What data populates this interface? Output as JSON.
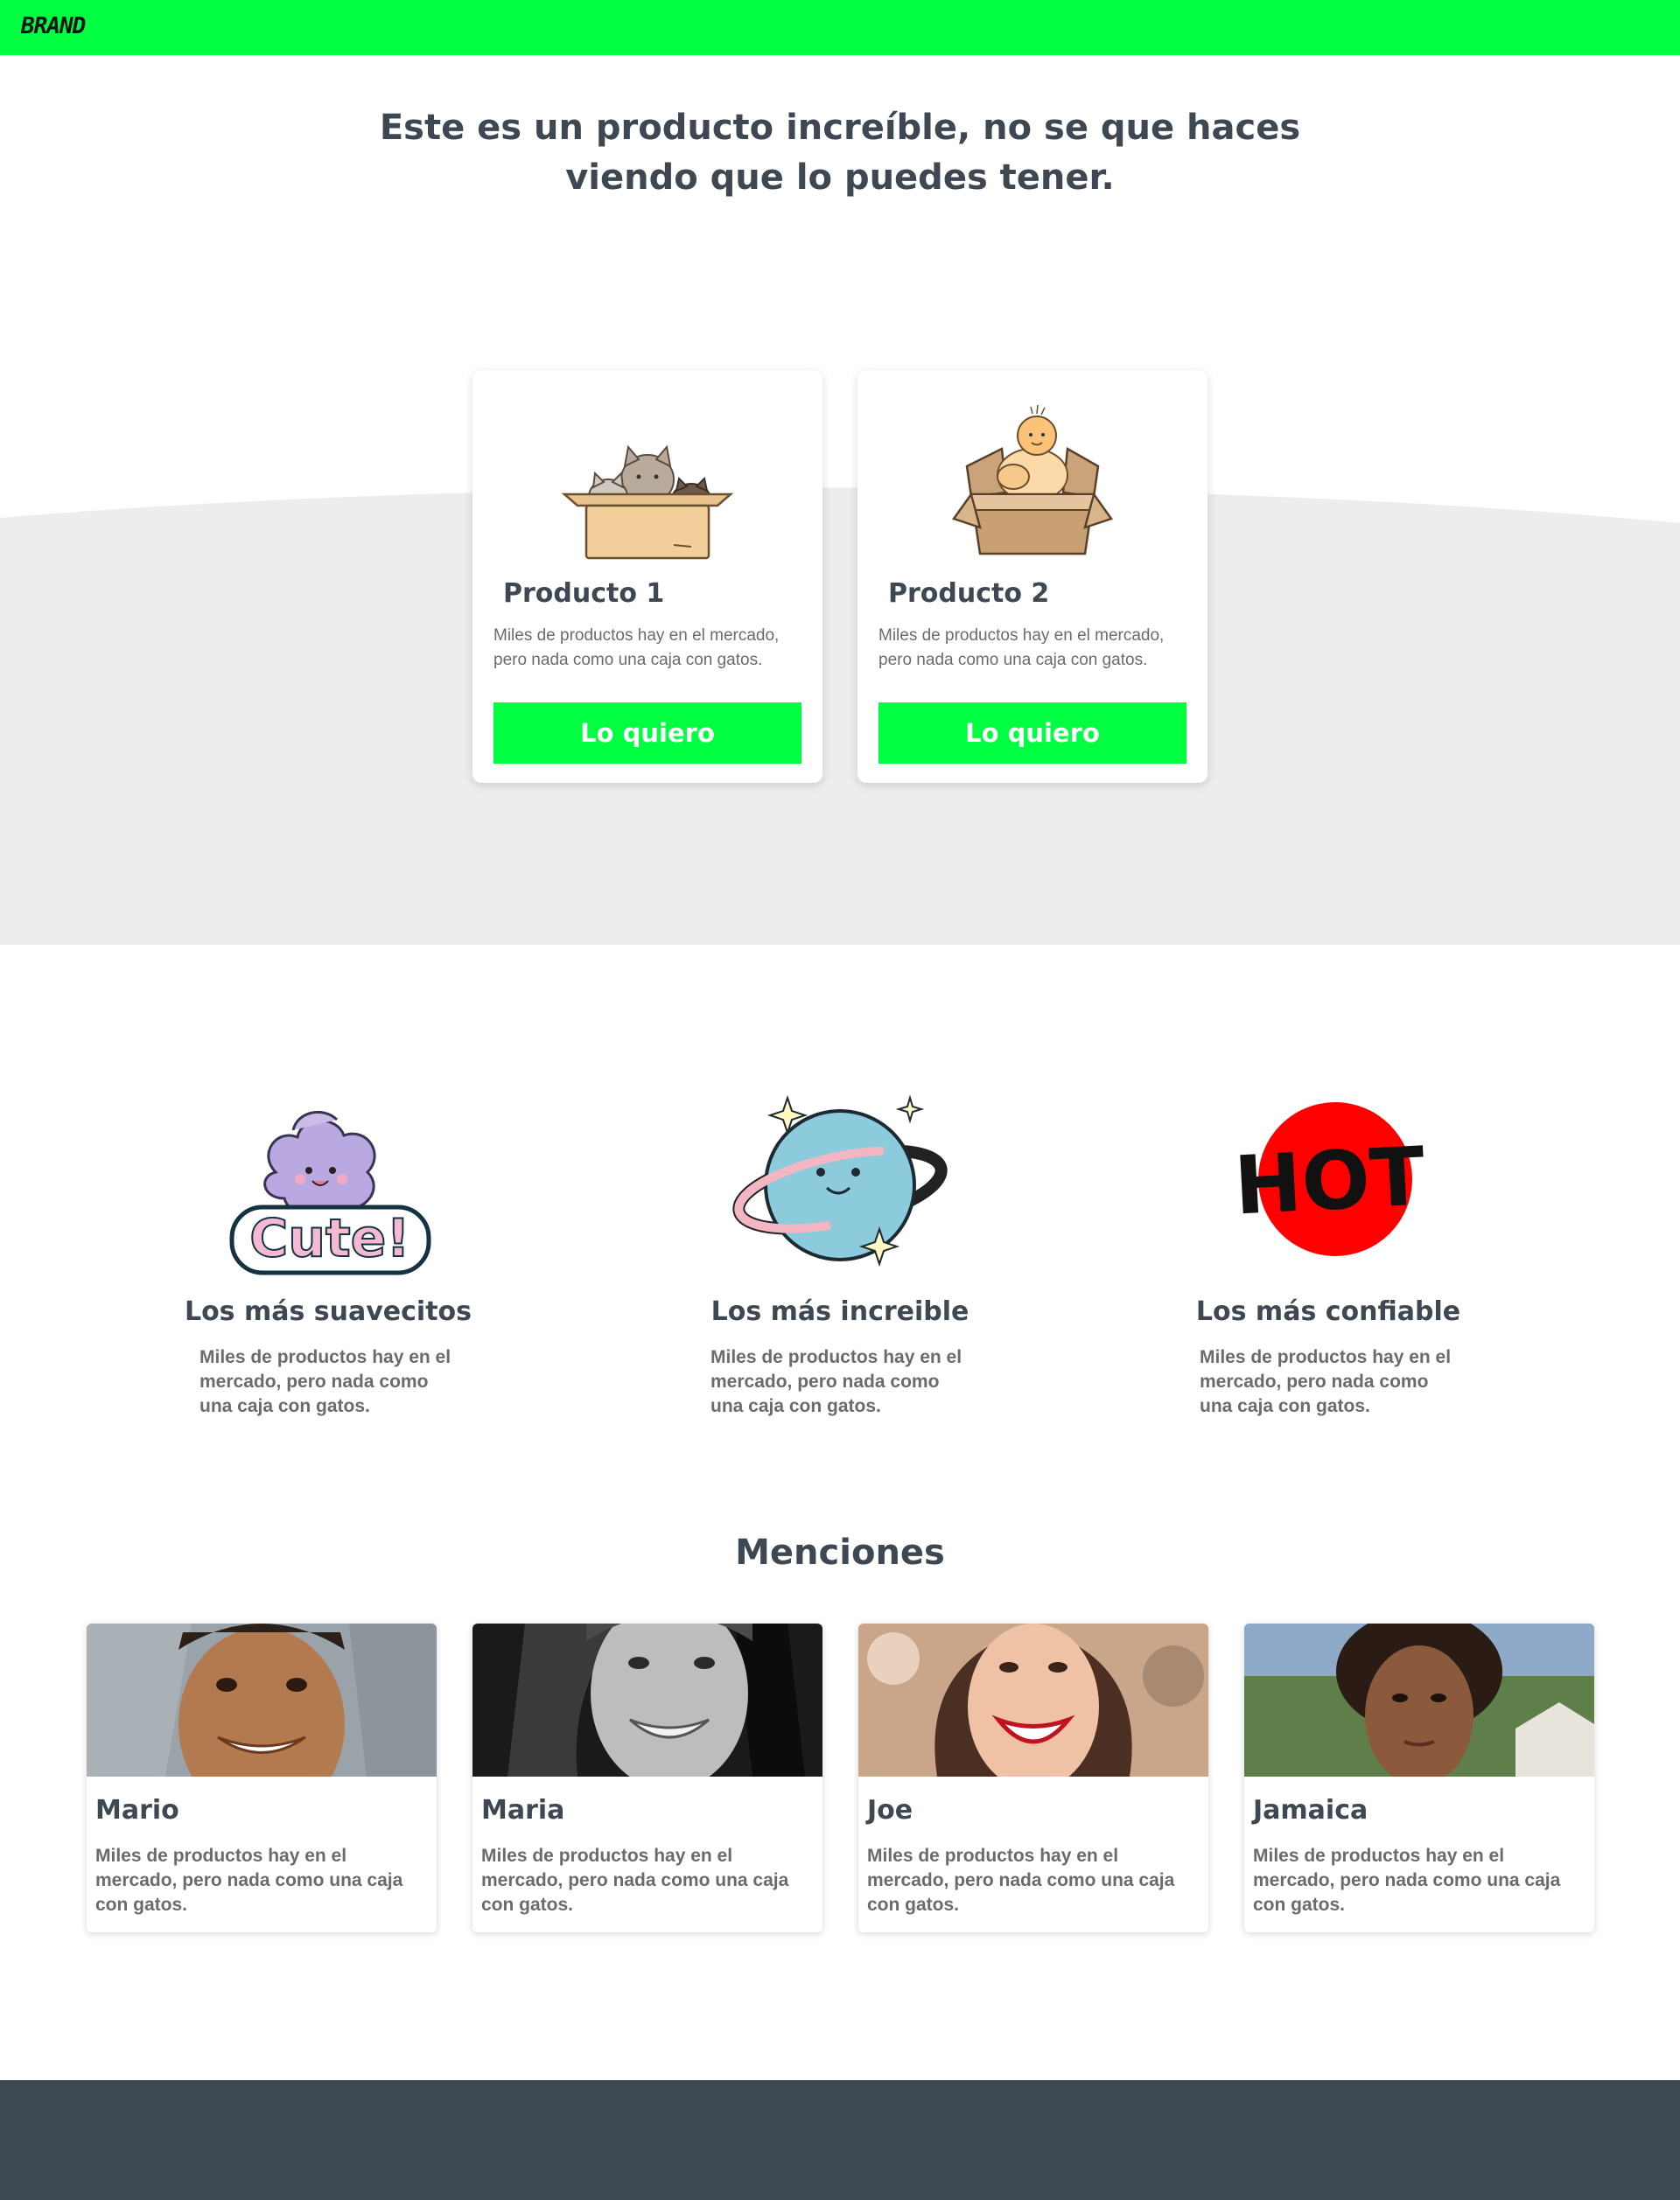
{
  "colors": {
    "accent": "#00ff40",
    "text_dark": "#3d4852",
    "text_muted": "#6b6b6b",
    "band_gray": "#ededed",
    "footer": "#3d4852"
  },
  "navbar": {
    "brand": "BRAND"
  },
  "hero": {
    "title": "Este es un producto increíble, no se que haces viendo que lo puedes tener."
  },
  "products": [
    {
      "title": "Producto 1",
      "description": "Miles de productos hay en el mercado, pero nada como una caja con gatos.",
      "button": "Lo quiero",
      "icon": "cats-in-box-illustration"
    },
    {
      "title": "Producto 2",
      "description": "Miles de productos hay en el mercado, pero nada como una caja con gatos.",
      "button": "Lo quiero",
      "icon": "baby-in-box-illustration"
    }
  ],
  "features": [
    {
      "title": "Los más suavecitos",
      "description": "Miles de productos hay en el mercado, pero nada como una caja con gatos.",
      "icon": "cute-sticker"
    },
    {
      "title": "Los más increible",
      "description": "Miles de productos hay en el mercado, pero nada como una caja con gatos.",
      "icon": "planet-sticker"
    },
    {
      "title": "Los más confiable",
      "description": "Miles de productos hay en el mercado, pero nada como una caja con gatos.",
      "icon": "hot-sticker"
    }
  ],
  "mentions": {
    "title": "Menciones",
    "people": [
      {
        "name": "Mario",
        "description": "Miles de productos hay en el mercado, pero nada como una caja con gatos."
      },
      {
        "name": "Maria",
        "description": "Miles de productos hay en el mercado, pero nada como una caja con gatos."
      },
      {
        "name": "Joe",
        "description": "Miles de productos hay en el mercado, pero nada como una caja con gatos."
      },
      {
        "name": "Jamaica",
        "description": "Miles de productos hay en el mercado, pero nada como una caja con gatos."
      }
    ]
  }
}
